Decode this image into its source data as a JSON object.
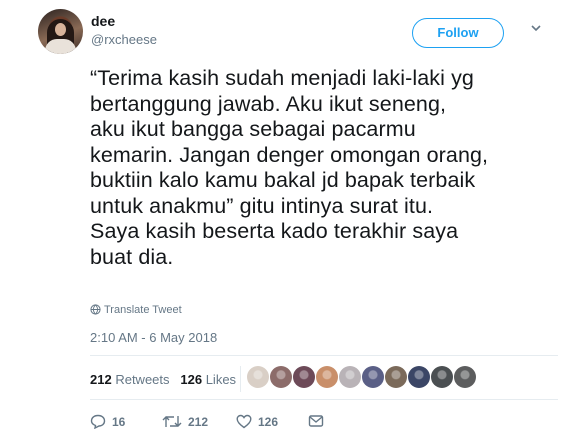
{
  "author": {
    "name": "dee",
    "handle": "@rxcheese"
  },
  "follow_label": "Follow",
  "tweet_text": "“Terima kasih sudah menjadi laki-laki yg\nbertanggung jawab. Aku ikut seneng,\naku ikut bangga sebagai pacarmu\nkemarin. Jangan denger omongan orang,\nbuktiin kalo kamu bakal jd bapak terbaik\nuntuk anakmu” gitu intinya surat itu.\nSaya kasih beserta kado terakhir saya\nbuat dia.",
  "translate_label": "Translate Tweet",
  "timestamp": "2:10 AM - 6 May 2018",
  "stats": {
    "retweets_count": "212",
    "retweets_label": "Retweets",
    "likes_count": "126",
    "likes_label": "Likes"
  },
  "liker_avatars": [
    {
      "color": "#d9cfc6"
    },
    {
      "color": "#8c6c6a"
    },
    {
      "color": "#6d4a58"
    },
    {
      "color": "#c98f6a"
    },
    {
      "color": "#b9b3b7"
    },
    {
      "color": "#5a5f86"
    },
    {
      "color": "#7b6a5a"
    },
    {
      "color": "#3b4666"
    },
    {
      "color": "#4b4f52"
    },
    {
      "color": "#5c5d5e"
    }
  ],
  "actions": {
    "reply_count": "16",
    "retweet_count": "212",
    "like_count": "126"
  },
  "colors": {
    "accent": "#1da1f2",
    "muted": "#657786",
    "text": "#14171a",
    "divider": "#e6ecf0"
  }
}
